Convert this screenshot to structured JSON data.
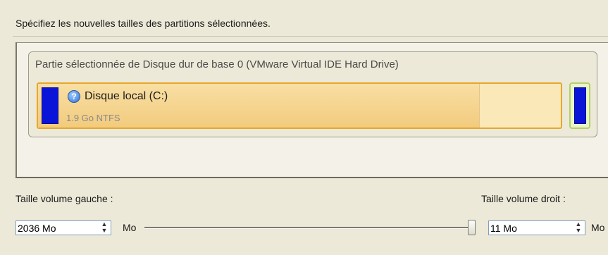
{
  "instruction": "Spécifiez les nouvelles tailles des partitions sélectionnées.",
  "disk": {
    "title": "Partie sélectionnée de Disque dur de base 0 (VMware Virtual IDE Hard Drive)",
    "partition": {
      "name": "Disque local (C:)",
      "size": "1.9 Go NTFS",
      "used_fraction": 0.84
    }
  },
  "left_volume": {
    "label": "Taille volume gauche :",
    "value": "2036 Mo",
    "unit": "Mo"
  },
  "right_volume": {
    "label": "Taille volume droit :",
    "value": "11 Mo",
    "unit": "Mo"
  },
  "slider": {
    "position_fraction": 0.99
  },
  "colors": {
    "partition_border": "#e8a72a",
    "volume_block": "#0a14d8",
    "free_part_border": "#b4cf6a"
  },
  "icons": {
    "help": "help-icon"
  }
}
